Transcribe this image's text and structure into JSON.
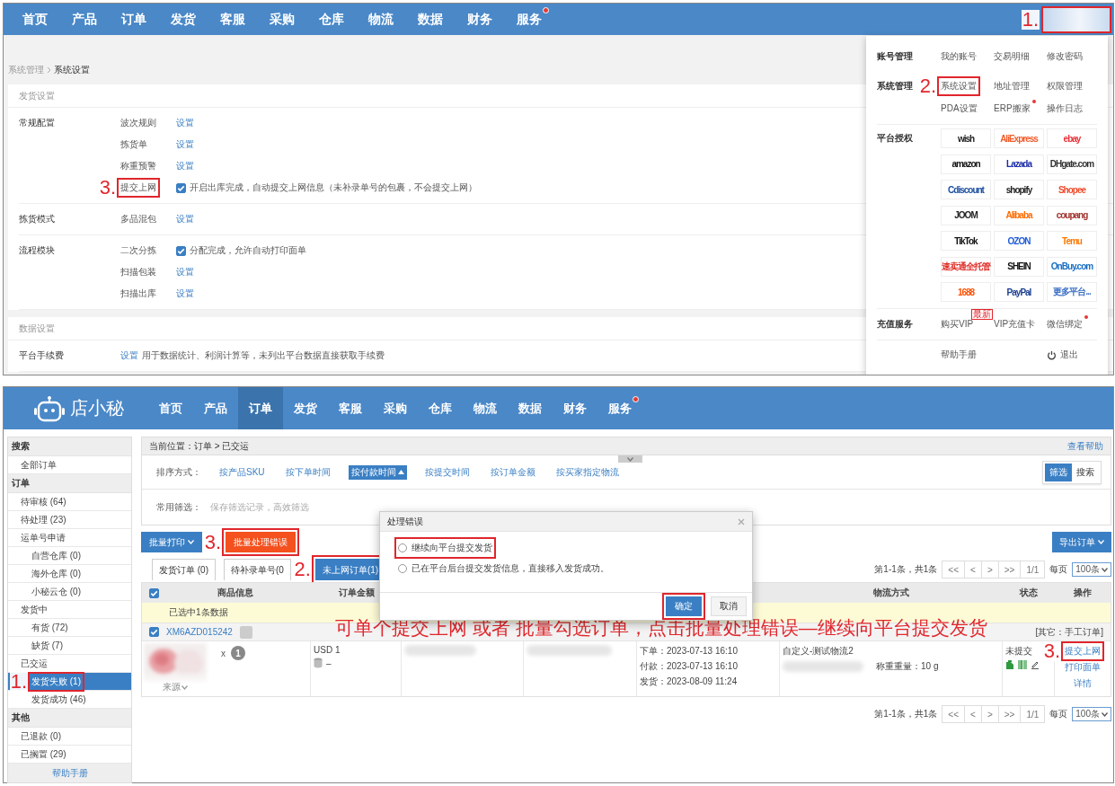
{
  "top": {
    "nav": [
      {
        "label": "首页"
      },
      {
        "label": "产品"
      },
      {
        "label": "订单"
      },
      {
        "label": "发货"
      },
      {
        "label": "客服"
      },
      {
        "label": "采购"
      },
      {
        "label": "仓库"
      },
      {
        "label": "物流"
      },
      {
        "label": "数据"
      },
      {
        "label": "财务"
      },
      {
        "label": "服务",
        "dot": true
      }
    ],
    "avatar": {
      "highlight": true,
      "marker": "1."
    },
    "breadcrumb": {
      "parent": "系统管理",
      "current": "系统设置"
    },
    "sections": [
      {
        "title": "发货设置",
        "groups": [
          {
            "label": "常规配置",
            "rows": [
              {
                "kind": "link",
                "name": "波次规则",
                "text": "设置"
              },
              {
                "kind": "link",
                "name": "拣货单",
                "text": "设置"
              },
              {
                "kind": "link",
                "name": "称重预警",
                "text": "设置"
              },
              {
                "kind": "checkbox",
                "name": "提交上网",
                "checked": true,
                "text": "开启出库完成，自动提交上网信息（未补录单号的包裹，不会提交上网）",
                "highlight": true,
                "marker": "3."
              }
            ]
          },
          {
            "label": "拣货模式",
            "rows": [
              {
                "kind": "link",
                "name": "多品混包",
                "text": "设置"
              }
            ]
          },
          {
            "label": "流程模块",
            "rows": [
              {
                "kind": "checkbox",
                "name": "二次分拣",
                "checked": true,
                "text": "分配完成，允许自动打印面单"
              },
              {
                "kind": "link",
                "name": "扫描包装",
                "text": "设置"
              },
              {
                "kind": "link",
                "name": "扫描出库",
                "text": "设置"
              }
            ]
          }
        ]
      },
      {
        "title": "数据设置",
        "groups": [
          {
            "label": "平台手续费",
            "rows": [
              {
                "kind": "link_note",
                "text": "设置",
                "note": "用于数据统计、利润计算等，未列出平台数据直接获取手续费"
              }
            ]
          }
        ]
      }
    ],
    "menu": {
      "rows": [
        {
          "label": "账号管理",
          "items": [
            {
              "text": "我的账号"
            },
            {
              "text": "交易明细"
            },
            {
              "text": "修改密码"
            }
          ]
        },
        {
          "label": "系统管理",
          "items": [
            {
              "text": "系统设置",
              "highlight": true,
              "marker": "2."
            },
            {
              "text": "地址管理"
            },
            {
              "text": "权限管理"
            },
            {
              "text": "PDA设置"
            },
            {
              "text": "ERP搬家",
              "dot": true
            },
            {
              "text": "操作日志"
            }
          ]
        }
      ],
      "platforms_label": "平台授权",
      "platforms": [
        {
          "name": "wish",
          "color": "#222222"
        },
        {
          "name": "AliExpress",
          "color": "#f25c2a"
        },
        {
          "name": "ebay",
          "color": "#e53238"
        },
        {
          "name": "amazon",
          "color": "#111111"
        },
        {
          "name": "Lazada",
          "color": "#1a2aa8"
        },
        {
          "name": "DHgate.com",
          "color": "#333333"
        },
        {
          "name": "Cdiscount",
          "color": "#1d4fa0"
        },
        {
          "name": "shopify",
          "color": "#222222"
        },
        {
          "name": "Shopee",
          "color": "#ee4d2d"
        },
        {
          "name": "JOOM",
          "color": "#222222"
        },
        {
          "name": "Alibaba",
          "color": "#ff6a00"
        },
        {
          "name": "coupang",
          "color": "#a0322c"
        },
        {
          "name": "TikTok",
          "color": "#111111"
        },
        {
          "name": "OZON",
          "color": "#1f5bd8"
        },
        {
          "name": "Temu",
          "color": "#fb7701"
        },
        {
          "name": "速卖通全托管",
          "color": "#e0302a"
        },
        {
          "name": "SHEIN",
          "color": "#111111"
        },
        {
          "name": "OnBuy.com",
          "color": "#1a6fc4"
        },
        {
          "name": "1688",
          "color": "#ff5000"
        },
        {
          "name": "PayPal",
          "color": "#1b3f8f"
        },
        {
          "name": "更多平台...",
          "color": "#3b6fc4"
        }
      ],
      "services_label": "充值服务",
      "services": [
        {
          "text": "购买VIP",
          "badge": "最新"
        },
        {
          "text": "VIP充值卡"
        },
        {
          "text": "微信绑定",
          "dot": true
        }
      ],
      "help": "帮助手册",
      "logout": "退出"
    }
  },
  "bottom": {
    "logo": "店小秘",
    "nav": [
      {
        "label": "首页",
        "selected": false
      },
      {
        "label": "产品",
        "selected": false
      },
      {
        "label": "订单",
        "selected": true
      },
      {
        "label": "发货",
        "selected": false
      },
      {
        "label": "客服",
        "selected": false
      },
      {
        "label": "采购",
        "selected": false
      },
      {
        "label": "仓库",
        "selected": false
      },
      {
        "label": "物流",
        "selected": false
      },
      {
        "label": "数据",
        "selected": false
      },
      {
        "label": "财务",
        "selected": false
      },
      {
        "label": "服务",
        "selected": false,
        "dot": true
      }
    ],
    "sidebar": [
      {
        "kind": "header",
        "text": "搜索",
        "children": [
          {
            "kind": "item",
            "text": "全部订单",
            "selected": false
          }
        ]
      },
      {
        "kind": "header",
        "text": "订单",
        "children": [
          {
            "kind": "item",
            "text": "待审核 (64)",
            "selected": false
          },
          {
            "kind": "item",
            "text": "待处理 (23)",
            "selected": false
          },
          {
            "kind": "item",
            "text": "运单号申请",
            "selected": false,
            "children": [
              {
                "kind": "item",
                "text": "自营仓库 (0)",
                "selected": false
              },
              {
                "kind": "item",
                "text": "海外仓库 (0)",
                "selected": false
              },
              {
                "kind": "item",
                "text": "小秘云仓 (0)",
                "selected": false
              }
            ]
          },
          {
            "kind": "item",
            "text": "发货中",
            "selected": false,
            "children": [
              {
                "kind": "item",
                "text": "有货 (72)",
                "selected": false
              },
              {
                "kind": "item",
                "text": "缺货 (7)",
                "selected": false
              }
            ]
          },
          {
            "kind": "item",
            "text": "已交运",
            "selected": false,
            "children": [
              {
                "kind": "item",
                "text": "发货失败 (1)",
                "selected": true,
                "highlight": true,
                "marker": "1."
              },
              {
                "kind": "item",
                "text": "发货成功 (46)",
                "selected": false
              }
            ]
          }
        ]
      },
      {
        "kind": "header",
        "text": "其他",
        "children": [
          {
            "kind": "item",
            "text": "已退款 (0)",
            "selected": false
          },
          {
            "kind": "item",
            "text": "已搁置 (29)",
            "selected": false
          }
        ]
      }
    ],
    "sidebar_help": "帮助手册",
    "location": "当前位置：订单 > 已交运",
    "help_link": "查看帮助",
    "sort_label": "排序方式：",
    "sort_options": [
      {
        "text": "按产品SKU",
        "selected": false
      },
      {
        "text": "按下单时间",
        "selected": false
      },
      {
        "text": "按付款时间",
        "selected": true
      },
      {
        "text": "按提交时间",
        "selected": false
      },
      {
        "text": "按订单金额",
        "selected": false
      },
      {
        "text": "按买家指定物流",
        "selected": false
      }
    ],
    "view_toggle": [
      {
        "text": "筛选",
        "selected": true
      },
      {
        "text": "搜索",
        "selected": false
      }
    ],
    "filter_label": "常用筛选：",
    "filter_hint": "保存筛选记录，高效筛选",
    "actions": [
      {
        "text": "批量打印",
        "kind": "primary"
      },
      {
        "text": "批量处理错误",
        "kind": "danger",
        "highlight": true,
        "marker": "3."
      }
    ],
    "export": "导出订单",
    "tabs": [
      {
        "text": "发货订单 (0)",
        "selected": false
      },
      {
        "text": "待补录单号(0",
        "selected": false
      },
      {
        "text": "未上网订单(1)",
        "selected": true,
        "highlight": true,
        "marker": "2."
      }
    ],
    "pagination_top": {
      "summary": "第1-1条，共1条",
      "buttons": [
        "<<",
        "<",
        ">",
        ">>"
      ],
      "page": "1/1",
      "per_page_label": "每页",
      "per_page": "100条"
    },
    "header_checked": true,
    "columns": [
      "商品信息",
      "订单金额",
      "物流方式",
      "状态",
      "操作"
    ],
    "selection_note": "已选中1条数据",
    "order": {
      "checked": true,
      "number": "XM6AZD015242",
      "tag": "[其它：手工订单]",
      "qty_prefix": "x",
      "qty": "1",
      "source": "来源",
      "amount": "USD 1",
      "cost": "–",
      "times": [
        "下单：2023-07-13 16:10",
        "付款：2023-07-13 16:10",
        "发货：2023-08-09 11:24"
      ],
      "logistics": "自定义-测试物流2",
      "weight": "称重重量：10 g",
      "status": "未提交",
      "operations": [
        {
          "text": "提交上网",
          "highlight": true,
          "marker": "3."
        },
        {
          "text": "打印面单"
        },
        {
          "text": "详情"
        }
      ]
    },
    "note": "可单个提交上网 或者 批量勾选订单，点击批量处理错误—继续向平台提交发货",
    "pagination_bottom": {
      "summary": "第1-1条，共1条",
      "buttons": [
        "<<",
        "<",
        ">",
        ">>"
      ],
      "page": "1/1",
      "per_page_label": "每页",
      "per_page": "100条"
    },
    "dialog": {
      "title": "处理错误",
      "options": [
        {
          "text": "继续向平台提交发货",
          "selected": false,
          "highlight": true
        },
        {
          "text": "已在平台后台提交发货信息，直接移入发货成功。",
          "selected": false
        }
      ],
      "buttons": [
        {
          "text": "确定",
          "kind": "primary",
          "highlight": true
        },
        {
          "text": "取消",
          "kind": "default"
        }
      ]
    }
  }
}
